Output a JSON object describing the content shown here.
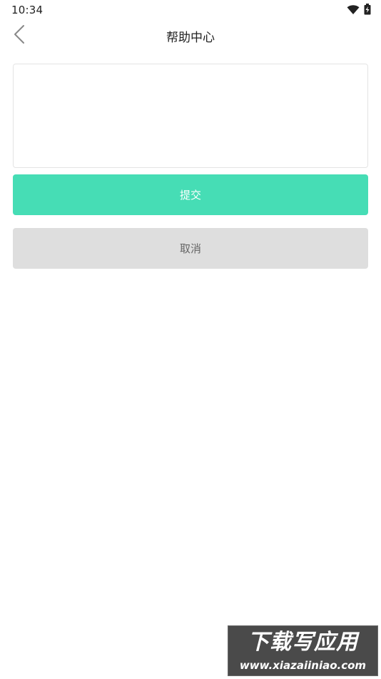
{
  "status_bar": {
    "time": "10:34",
    "icons": [
      "wifi-icon",
      "battery-charging-icon"
    ]
  },
  "header": {
    "title": "帮助中心",
    "back_icon": "chevron-left-icon"
  },
  "feedback": {
    "value": "",
    "placeholder": ""
  },
  "buttons": {
    "submit_label": "提交",
    "cancel_label": "取消"
  },
  "watermark": {
    "title": "下载写应用",
    "url": "www.xiazaiiniao.com"
  },
  "colors": {
    "submit_bg": "#46ddb5",
    "cancel_bg": "#dedede",
    "title_text": "#222222"
  }
}
